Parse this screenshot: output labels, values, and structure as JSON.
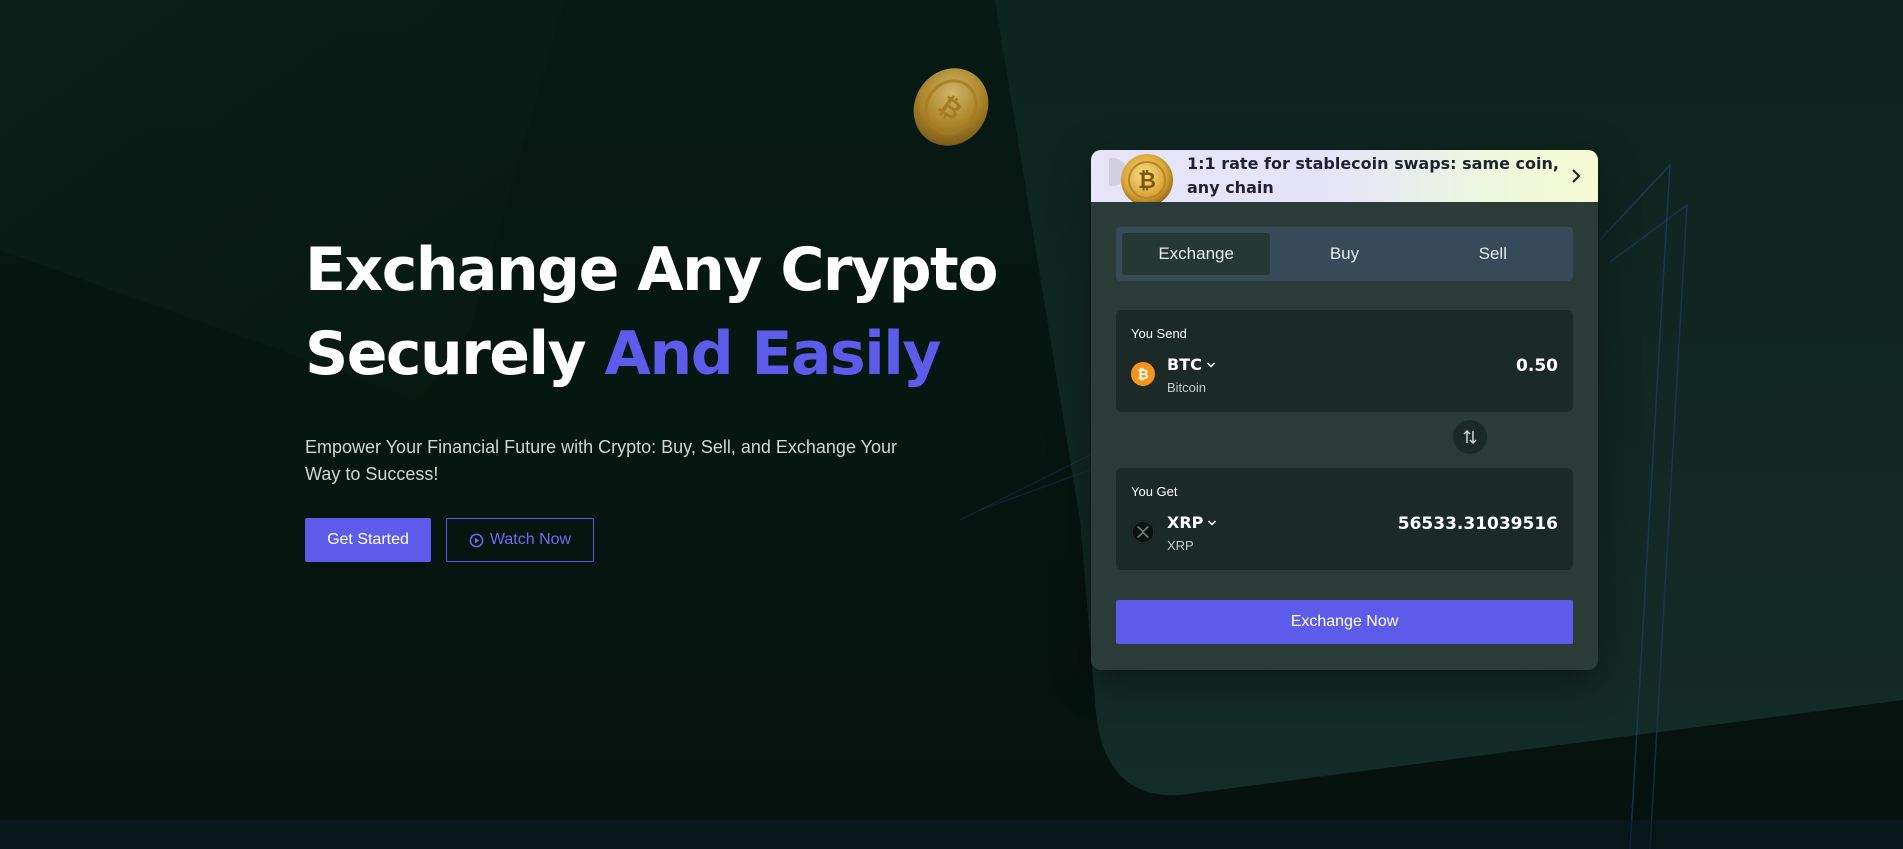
{
  "hero": {
    "title_line1": "Exchange Any Crypto",
    "title_line2_plain": "Securely ",
    "title_line2_accent": "And Easily",
    "subtitle": "Empower Your Financial Future with Crypto: Buy, Sell, and Exchange Your Way to Success!",
    "primary_button": "Get Started",
    "secondary_button": "Watch Now",
    "secondary_icon": "play-circle-icon"
  },
  "promo": {
    "text": "1:1 rate for stablecoin swaps: same coin, any chain",
    "icon": "bitcoin-coin-icon",
    "chevron": "chevron-right-icon"
  },
  "tabs": [
    {
      "label": "Exchange",
      "active": true
    },
    {
      "label": "Buy",
      "active": false
    },
    {
      "label": "Sell",
      "active": false
    }
  ],
  "send": {
    "label": "You Send",
    "symbol": "BTC",
    "name": "Bitcoin",
    "amount": "0.50",
    "icon": "bitcoin-icon"
  },
  "get": {
    "label": "You Get",
    "symbol": "XRP",
    "name": "XRP",
    "amount": "56533.31039516",
    "icon": "xrp-icon"
  },
  "swap_icon": "swap-vertical-icon",
  "cta": "Exchange Now",
  "colors": {
    "accent": "#5d5bea",
    "background": "#061510",
    "card": "#2a3b38",
    "panel": "#1b2a26",
    "bitcoin": "#f7931a"
  }
}
